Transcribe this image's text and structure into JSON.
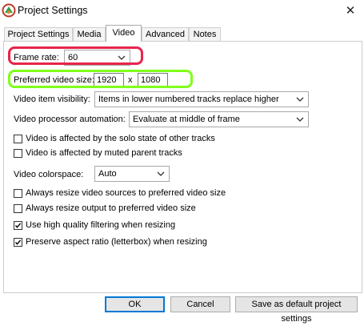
{
  "window": {
    "title": "Project Settings",
    "close_glyph": "✕",
    "icon": "reaper-logo-icon"
  },
  "tabs": [
    {
      "label": "Project Settings"
    },
    {
      "label": "Media"
    },
    {
      "label": "Video",
      "active": true
    },
    {
      "label": "Advanced"
    },
    {
      "label": "Notes"
    }
  ],
  "video": {
    "frame_rate_label": "Frame rate:",
    "frame_rate_value": "60",
    "pref_size_label": "Preferred video size:",
    "pref_width": "1920",
    "pref_x": "x",
    "pref_height": "1080",
    "item_visibility_label": "Video item visibility:",
    "item_visibility_value": "Items in lower numbered tracks replace higher",
    "processor_label": "Video processor automation:",
    "processor_value": "Evaluate at middle of frame",
    "solo_label": "Video is affected by the solo state of other tracks",
    "muted_label": "Video is affected by muted parent tracks",
    "colorspace_label": "Video colorspace:",
    "colorspace_value": "Auto",
    "resize_sources_label": "Always resize video sources to preferred video size",
    "resize_output_label": "Always resize output to preferred video size",
    "hq_filter_label": "Use high quality filtering when resizing",
    "aspect_label": "Preserve aspect ratio (letterbox) when resizing"
  },
  "checkboxes": {
    "solo": false,
    "muted": false,
    "resize_sources": false,
    "resize_output": false,
    "hq_filter": true,
    "aspect": true
  },
  "buttons": {
    "ok": "OK",
    "cancel": "Cancel",
    "save_default": "Save as default project settings"
  },
  "colors": {
    "highlight_red": "#e8244d",
    "highlight_green": "#7fff1a",
    "default_button_border": "#0078d7"
  }
}
